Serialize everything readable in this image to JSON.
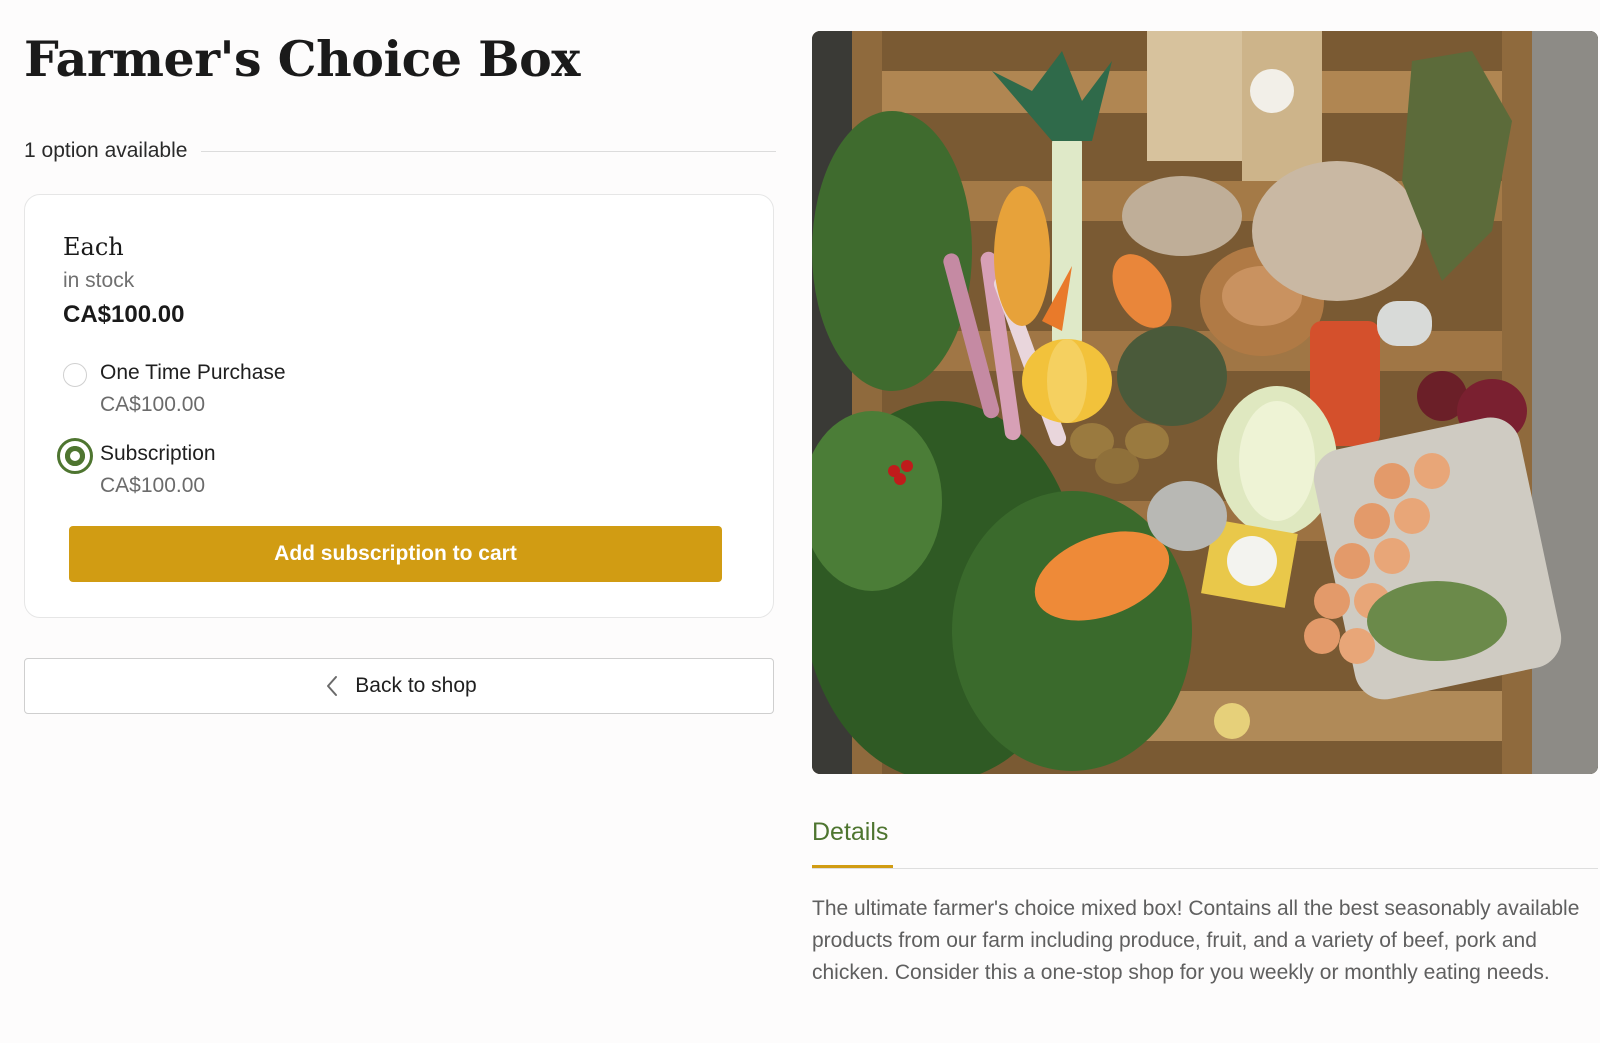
{
  "product": {
    "title": "Farmer's Choice Box",
    "options_available": "1 option available"
  },
  "variant": {
    "name": "Each",
    "stock": "in stock",
    "price": "CA$100.00",
    "purchase_options": [
      {
        "label": "One Time Purchase",
        "price": "CA$100.00",
        "selected": false
      },
      {
        "label": "Subscription",
        "price": "CA$100.00",
        "selected": true
      }
    ],
    "add_button": "Add subscription to cart"
  },
  "nav": {
    "back_label": "Back to shop",
    "back_icon": "chevron-left-icon"
  },
  "details": {
    "tab_label": "Details",
    "description": "The ultimate farmer's choice mixed box! Contains all the best seasonably available products from our farm including produce, fruit, and a variety of beef, pork and chicken. Consider this a one-stop shop for you weekly or monthly eating needs."
  },
  "image": {
    "subject": "product-photo"
  },
  "colors": {
    "accent_gold": "#d19c13",
    "accent_green": "#4e7530",
    "text_muted": "#6b6b6b"
  }
}
